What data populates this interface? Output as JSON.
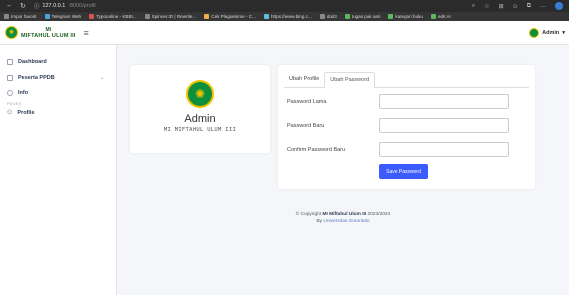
{
  "browser": {
    "url_host": "127.0.0.1",
    "url_rest": ":8000/profil",
    "bookmarks": [
      "Impor favorit",
      "Telegram Web",
      "Typoonline - KBBI...",
      "Spinner.ID | Rewrite...",
      "Cek Plagiarisme - C...",
      "https://www.bing.c...",
      "doit3",
      "tugas pak asri",
      "kategori buku",
      "edit AI"
    ]
  },
  "header": {
    "brand_top": "MI",
    "brand_name": "MIFTAHUL ULUM III",
    "user_label": "Admin"
  },
  "sidebar": {
    "items": [
      {
        "label": "Dashboard"
      },
      {
        "label": "Peserta PPDB"
      },
      {
        "label": "Info"
      }
    ],
    "section_heading": "PAGES",
    "profile_label": "Profile"
  },
  "profile_card": {
    "name": "Admin",
    "school": "MI MIFTAHUL ULUM III"
  },
  "password_card": {
    "tabs": [
      "Ubah Profile",
      "Ubah Password"
    ],
    "active_tab": "Ubah Password",
    "fields": [
      {
        "label": "Password Lama",
        "value": ""
      },
      {
        "label": "Password Baru",
        "value": ""
      },
      {
        "label": "Confirm Password Baru",
        "value": ""
      }
    ],
    "save_label": "Save Password"
  },
  "footer": {
    "prefix": "© Copyright",
    "school": "MI Miftahul Ulum III",
    "year": "2023/2024",
    "by_prefix": "By",
    "by_name": "Universitas Gorontalo"
  },
  "colors": {
    "accent": "#3b5bfd",
    "brand_green": "#0d8f3b",
    "brand_yellow": "#f2c200"
  }
}
